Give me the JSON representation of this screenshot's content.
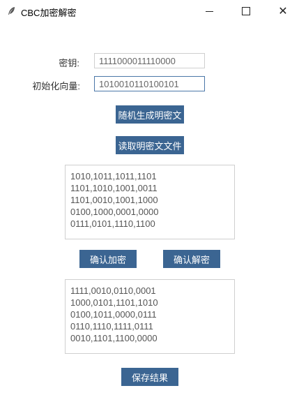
{
  "window": {
    "title": "CBC加密解密",
    "icon": "feather-icon"
  },
  "form": {
    "key_label": "密钥:",
    "key_value": "1111000011110000",
    "iv_label": "初始化向量:",
    "iv_value": "1010010110100101"
  },
  "buttons": {
    "random_plaintext": "随机生成明密文",
    "read_file": "读取明密文文件",
    "encrypt": "确认加密",
    "decrypt": "确认解密",
    "save": "保存结果"
  },
  "input_text": {
    "lines": [
      "1010,1011,1011,1101",
      "1101,1010,1001,0011",
      "1101,0010,1001,1000",
      "0100,1000,0001,0000",
      "0111,0101,1110,1100"
    ]
  },
  "output_text": {
    "lines": [
      "1111,0010,0110,0001",
      "1000,0101,1101,1010",
      "0100,1011,0000,0111",
      "0110,1110,1111,0111",
      "0010,1101,1100,0000"
    ]
  },
  "colors": {
    "button_bg": "#3b6592",
    "button_text": "#ffffff",
    "field_focus_border": "#4a77a8"
  }
}
